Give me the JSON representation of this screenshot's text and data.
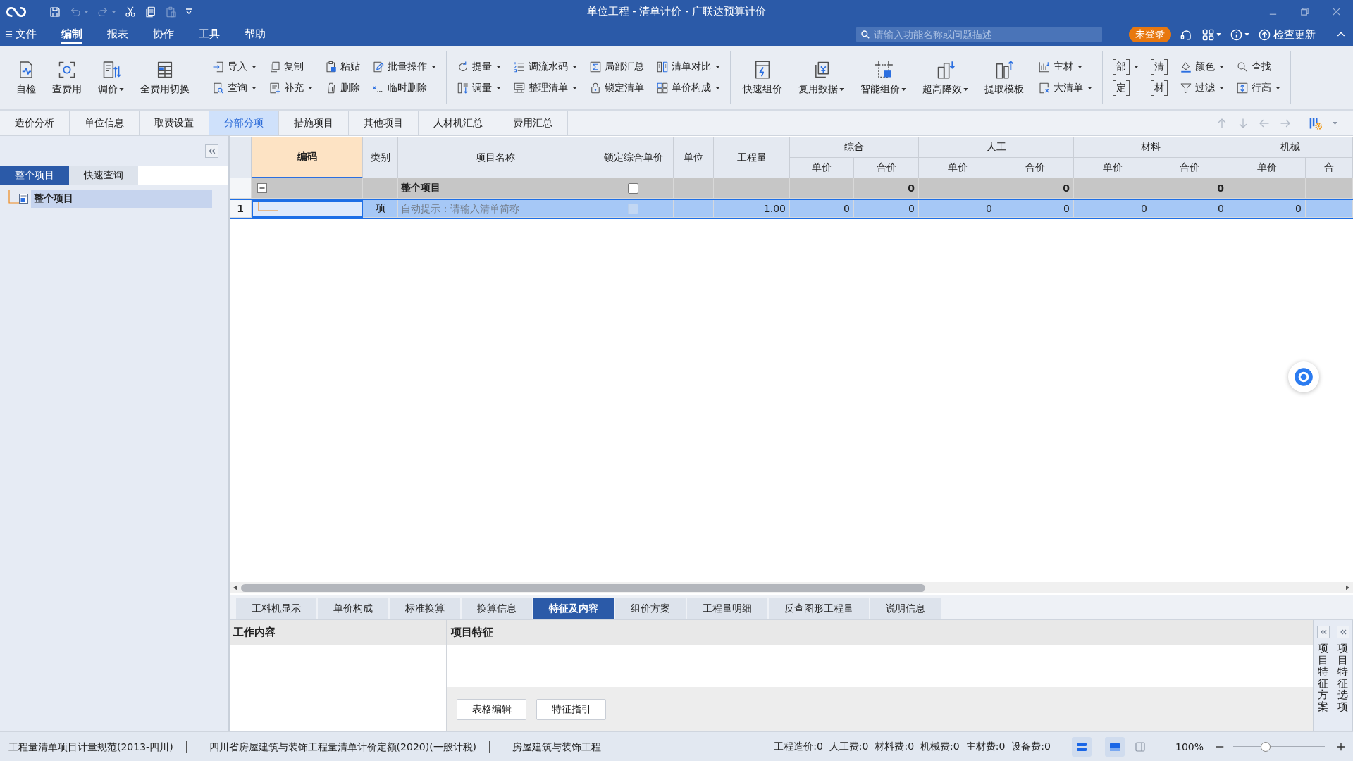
{
  "title_bar": {
    "title": "单位工程 - 清单计价 - 广联达预算计价",
    "quick_access": [
      {
        "disabled": false
      },
      {
        "disabled": true
      },
      {
        "disabled": true
      },
      {
        "disabled": false
      },
      {
        "disabled": false
      },
      {
        "disabled": true
      }
    ]
  },
  "menu_bar": {
    "items": [
      {
        "label": "文件",
        "selected": false
      },
      {
        "label": "编制",
        "selected": true
      },
      {
        "label": "报表",
        "selected": false
      },
      {
        "label": "协作",
        "selected": false
      },
      {
        "label": "工具",
        "selected": false
      },
      {
        "label": "帮助",
        "selected": false
      }
    ],
    "search": {
      "placeholder": "请输入功能名称或问题描述"
    },
    "login_badge": "未登录",
    "update_link": "检查更新"
  },
  "ribbon": {
    "groups": [
      {
        "items": [
          {
            "kind": "large",
            "label": "自检",
            "dropdown": false
          },
          {
            "kind": "large",
            "label": "查费用",
            "dropdown": false
          },
          {
            "kind": "large",
            "label": "调价",
            "dropdown": true
          },
          {
            "kind": "large",
            "label": "全费用切换",
            "dropdown": false
          }
        ]
      },
      {
        "items": [
          {
            "kind": "stack",
            "items": [
              {
                "kind": "small",
                "label": "导入",
                "dropdown": true
              },
              {
                "kind": "small",
                "label": "查询",
                "dropdown": true
              }
            ]
          },
          {
            "kind": "stack",
            "items": [
              {
                "kind": "small",
                "label": "复制",
                "dropdown": false
              },
              {
                "kind": "small",
                "label": "补充",
                "dropdown": true
              }
            ]
          },
          {
            "kind": "stack",
            "items": [
              {
                "kind": "small",
                "label": "粘贴",
                "dropdown": false
              },
              {
                "kind": "small",
                "label": "删除",
                "dropdown": false
              }
            ]
          },
          {
            "kind": "stack",
            "items": [
              {
                "kind": "small",
                "label": "批量操作",
                "dropdown": true
              },
              {
                "kind": "small",
                "label": "临时删除",
                "dropdown": false
              }
            ]
          }
        ]
      },
      {
        "items": [
          {
            "kind": "stack",
            "items": [
              {
                "kind": "small",
                "label": "提量",
                "dropdown": true
              },
              {
                "kind": "small",
                "label": "调量",
                "dropdown": true
              }
            ]
          },
          {
            "kind": "stack",
            "items": [
              {
                "kind": "small",
                "label": "调流水码",
                "dropdown": true
              },
              {
                "kind": "small",
                "label": "整理清单",
                "dropdown": true
              }
            ]
          },
          {
            "kind": "stack",
            "items": [
              {
                "kind": "small",
                "label": "局部汇总",
                "dropdown": false
              },
              {
                "kind": "small",
                "label": "锁定清单",
                "dropdown": false
              }
            ]
          },
          {
            "kind": "stack",
            "items": [
              {
                "kind": "small",
                "label": "清单对比",
                "dropdown": true
              },
              {
                "kind": "small",
                "label": "单价构成",
                "dropdown": true
              }
            ]
          }
        ]
      },
      {
        "items": [
          {
            "kind": "large",
            "label": "快速组价",
            "dropdown": false
          },
          {
            "kind": "large",
            "label": "复用数据",
            "dropdown": true
          },
          {
            "kind": "large",
            "label": "智能组价",
            "dropdown": true
          },
          {
            "kind": "large",
            "label": "超高降效",
            "dropdown": true
          },
          {
            "kind": "large",
            "label": "提取模板",
            "dropdown": false
          },
          {
            "kind": "stack",
            "items": [
              {
                "kind": "small",
                "label": "主材",
                "dropdown": true
              },
              {
                "kind": "small",
                "label": "大清单",
                "dropdown": true
              }
            ]
          }
        ]
      },
      {
        "items": [
          {
            "kind": "stack",
            "items": [
              {
                "kind": "glyph",
                "label": "部",
                "dropdown": true
              },
              {
                "kind": "glyph",
                "label": "定",
                "dropdown": false
              }
            ]
          },
          {
            "kind": "stack",
            "items": [
              {
                "kind": "glyph",
                "label": "清",
                "dropdown": false
              },
              {
                "kind": "glyph",
                "label": "材",
                "dropdown": false
              }
            ]
          },
          {
            "kind": "stack",
            "items": [
              {
                "kind": "small",
                "label": "颜色",
                "dropdown": true
              },
              {
                "kind": "small",
                "label": "过滤",
                "dropdown": true
              }
            ]
          },
          {
            "kind": "stack",
            "items": [
              {
                "kind": "small",
                "label": "查找",
                "dropdown": false
              },
              {
                "kind": "small",
                "label": "行高",
                "dropdown": true
              }
            ]
          }
        ]
      }
    ]
  },
  "main_tabs": [
    {
      "label": "造价分析",
      "selected": false
    },
    {
      "label": "单位信息",
      "selected": false
    },
    {
      "label": "取费设置",
      "selected": false
    },
    {
      "label": "分部分项",
      "selected": true
    },
    {
      "label": "措施项目",
      "selected": false
    },
    {
      "label": "其他项目",
      "selected": false
    },
    {
      "label": "人材机汇总",
      "selected": false
    },
    {
      "label": "费用汇总",
      "selected": false
    }
  ],
  "nav_arrows": [
    {
      "disabled": true
    },
    {
      "disabled": true
    },
    {
      "disabled": true
    },
    {
      "disabled": true
    }
  ],
  "left_panel": {
    "tabs": [
      {
        "label": "整个项目",
        "selected": true
      },
      {
        "label": "快速查询",
        "selected": false
      }
    ],
    "tree": [
      {
        "label": "整个项目",
        "selected": true
      }
    ]
  },
  "grid": {
    "columns": [
      {
        "label": "编码",
        "selected": true
      },
      {
        "label": "类别",
        "selected": false
      },
      {
        "label": "项目名称",
        "selected": false
      },
      {
        "label": "锁定综合单价",
        "selected": false
      },
      {
        "label": "单位",
        "selected": false
      },
      {
        "label": "工程量",
        "selected": false
      }
    ],
    "price_groups": [
      {
        "label": "综合",
        "sub": [
          "单价",
          "合价"
        ]
      },
      {
        "label": "人工",
        "sub": [
          "单价",
          "合价"
        ]
      },
      {
        "label": "材料",
        "sub": [
          "单价",
          "合价"
        ]
      },
      {
        "label": "机械",
        "sub": [
          "单价",
          "合"
        ]
      }
    ],
    "rows": [
      {
        "kind": "group",
        "selected": false,
        "expanded": true,
        "name": "整个项目",
        "lock": {
          "checked": false,
          "disabled": false
        },
        "prices": [
          {
            "total": "0"
          },
          {
            "total": "0"
          },
          {
            "total": "0"
          }
        ]
      },
      {
        "kind": "item",
        "selected": true,
        "number": "1",
        "type": "项",
        "placeholder": "自动提示：请输入清单简称",
        "lock": {
          "checked": false,
          "disabled": true
        },
        "quantity": "1.00",
        "prices": [
          {
            "unit": "0",
            "total": "0"
          },
          {
            "unit": "0",
            "total": "0"
          },
          {
            "unit": "0",
            "total": "0"
          },
          {
            "unit": "0"
          }
        ]
      }
    ]
  },
  "detail_tabs": [
    {
      "label": "工料机显示",
      "selected": false
    },
    {
      "label": "单价构成",
      "selected": false
    },
    {
      "label": "标准换算",
      "selected": false
    },
    {
      "label": "换算信息",
      "selected": false
    },
    {
      "label": "特征及内容",
      "selected": true
    },
    {
      "label": "组价方案",
      "selected": false
    },
    {
      "label": "工程量明细",
      "selected": false
    },
    {
      "label": "反查图形工程量",
      "selected": false
    },
    {
      "label": "说明信息",
      "selected": false
    }
  ],
  "detail_panel": {
    "work_content_title": "工作内容",
    "features_title": "项目特征",
    "buttons": [
      "表格编辑",
      "特征指引"
    ],
    "side_tabs": [
      "项目特征方案",
      "项目特征选项"
    ]
  },
  "status_bar": {
    "standards": [
      "工程量清单项目计量规范(2013-四川)",
      "四川省房屋建筑与装饰工程量清单计价定额(2020)(一般计税)",
      "房屋建筑与装饰工程"
    ],
    "totals": [
      "工程造价:0",
      "人工费:0",
      "材料费:0",
      "机械费:0",
      "主材费:0",
      "设备费:0"
    ],
    "panel_toggle_on": true,
    "views": [
      {
        "selected": true
      },
      {
        "selected": false
      }
    ],
    "zoom": {
      "reading": "100%",
      "level": 0.35
    }
  }
}
